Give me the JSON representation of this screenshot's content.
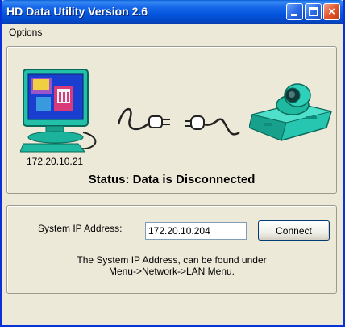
{
  "window": {
    "title": "HD Data Utility Version 2.6",
    "controls": {
      "close_glyph": "×"
    }
  },
  "menu": {
    "items": [
      "Options"
    ]
  },
  "status_panel": {
    "local_ip": "172.20.10.21",
    "status_text": "Status: Data is Disconnected",
    "icons": [
      "computer-monitor-icon",
      "cable-plug-icon",
      "cable-plug-icon",
      "videoconference-codec-icon"
    ]
  },
  "connect_panel": {
    "ip_label": "System IP Address:",
    "ip_value": "172.20.10.204",
    "connect_label": "Connect",
    "hint_line1": "The System IP Address, can be found under",
    "hint_line2": "Menu->Network->LAN Menu."
  },
  "colors": {
    "titlebar_blue": "#0455dd",
    "window_face": "#ece9d8",
    "close_red": "#e2572c"
  }
}
